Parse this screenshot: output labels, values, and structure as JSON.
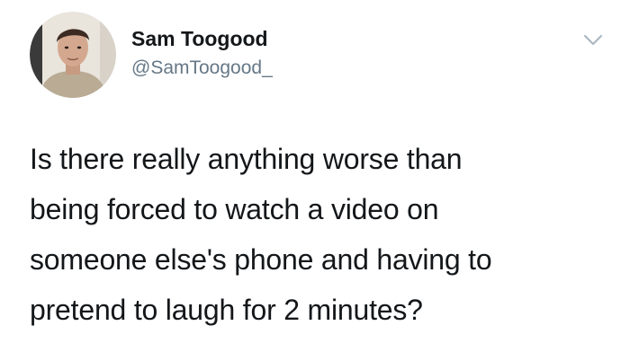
{
  "author": {
    "display_name": "Sam Toogood",
    "handle": "@SamToogood_"
  },
  "tweet": {
    "lines": [
      "Is there really anything worse than",
      "being forced to watch a video on",
      "someone else's phone and having to",
      "pretend to laugh for 2 minutes?"
    ]
  },
  "icons": {
    "menu": "chevron-down-icon",
    "avatar": "profile-photo"
  },
  "colors": {
    "name": "#14171a",
    "handle": "#657786",
    "text": "#14171a",
    "caret": "#aab8c2"
  }
}
